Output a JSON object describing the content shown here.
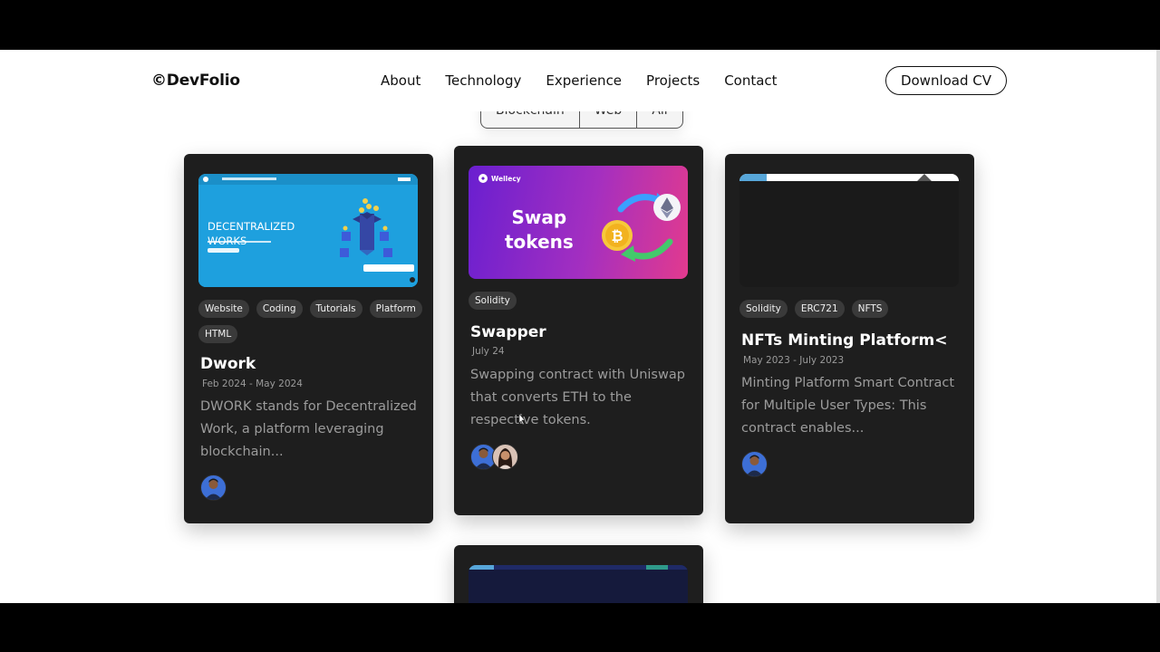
{
  "brand": {
    "logo": "©DevFolio"
  },
  "nav": {
    "items": [
      "About",
      "Technology",
      "Experience",
      "Projects",
      "Contact"
    ],
    "cv_button": "Download CV"
  },
  "filters": [
    "Blockchain",
    "Web",
    "All"
  ],
  "cards": [
    {
      "thumb": {
        "hero_title_line1": "DECENTRALIZED",
        "hero_title_line2": "WORKS"
      },
      "tags": [
        "Website",
        "Coding",
        "Tutorials",
        "Platform",
        "HTML"
      ],
      "title": "Dwork",
      "date": "Feb 2024 - May 2024",
      "description": "DWORK stands for Decentralized Work, a platform leveraging blockchain..."
    },
    {
      "thumb": {
        "brand": "Wellecy",
        "headline_line1": "Swap",
        "headline_line2": "tokens"
      },
      "tags": [
        "Solidity"
      ],
      "title": "Swapper",
      "date": "July 24",
      "description": "Swapping contract with Uniswap that converts ETH to the respective tokens."
    },
    {
      "tags": [
        "Solidity",
        "ERC721",
        "NFTS"
      ],
      "title": "NFTs Minting Platform<",
      "date": "May 2023 - July 2023",
      "description": "Minting Platform Smart Contract for Multiple User Types: This contract enables..."
    }
  ],
  "colors": {
    "card_bg": "#1e1e1e",
    "tag_bg": "#3a3a3a",
    "dwork_thumb": "#1fa3e0",
    "swap_gradient_start": "#7a1fd1",
    "swap_gradient_end": "#e0368a"
  }
}
